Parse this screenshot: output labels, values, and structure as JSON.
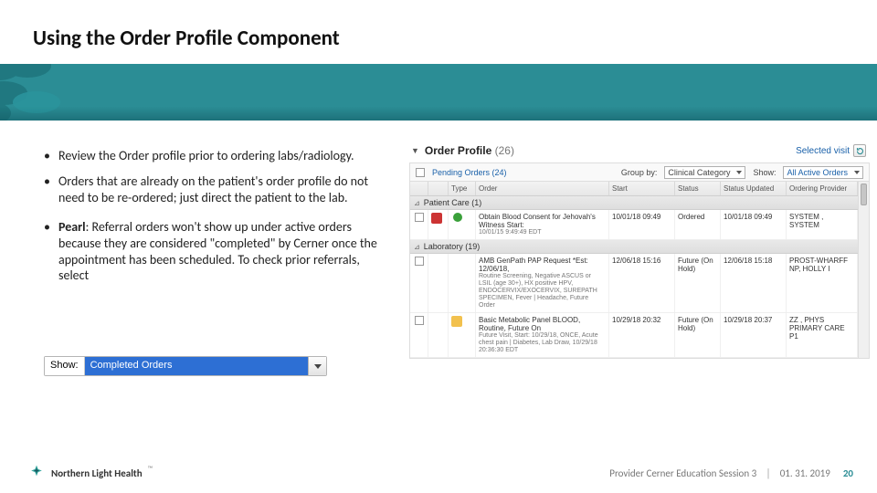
{
  "title": "Using the Order Profile Component",
  "bullets": [
    "Review the Order profile prior to ordering labs/radiology.",
    "Orders that are already on the patient's order profile do not need to be re-ordered; just direct the patient to the lab.",
    "Pearl: Referral orders won't show up under active orders because they are considered \"completed\" by Cerner once the appointment has been scheduled.  To check prior referrals, select"
  ],
  "dropdown": {
    "label": "Show:",
    "value": "Completed Orders"
  },
  "panel": {
    "title": "Order Profile",
    "count": "(26)",
    "selected_visit": "Selected visit",
    "filter": {
      "pending": "Pending Orders (24)",
      "group_lbl": "Group by:",
      "group_val": "Clinical Category",
      "show_lbl": "Show:",
      "show_val": "All Active Orders"
    },
    "columns": [
      "",
      "",
      "Type",
      "Order",
      "Start",
      "Status",
      "Status Updated",
      "Ordering Provider"
    ],
    "groups": [
      {
        "label": "Patient Care (1)",
        "rows": [
          {
            "order": "Obtain Blood Consent for Jehovah's Witness Start:",
            "sub": "10/01/15 9:49:49 EDT",
            "start": "10/01/18 09:49",
            "status": "Ordered",
            "updated": "10/01/18 09:49",
            "provider": "SYSTEM , SYSTEM",
            "icon": "red-green"
          }
        ]
      },
      {
        "label": "Laboratory (19)",
        "rows": [
          {
            "order": "AMB GenPath PAP Request  *Est: 12/06/18,",
            "sub": "Routine Screening, Negative ASCUS or LSIL (age 30+), HX positive HPV, ENDOCERVIX/EXOCERVIX, SUREPATH SPECIMEN, Fever | Headache, Future Order",
            "start": "12/06/18 15:16",
            "status": "Future (On Hold)",
            "updated": "12/06/18 15:18",
            "provider": "PROST-WHARFF NP, HOLLY I",
            "icon": ""
          },
          {
            "order": "Basic Metabolic Panel  BLOOD, Routine, Future On",
            "sub": "Future Visit, Start: 10/29/18, ONCE, Acute chest pain | Diabetes, Lab Draw, 10/29/18 20:36:30 EDT",
            "start": "10/29/18 20:32",
            "status": "Future (On Hold)",
            "updated": "10/29/18 20:37",
            "provider": "ZZ , PHYS PRIMARY CARE P1",
            "icon": "yellow"
          }
        ]
      }
    ]
  },
  "footer": {
    "brand": "Northern Light Health",
    "session": "Provider Cerner Education Session 3",
    "date": "01. 31. 2019",
    "page": "20"
  }
}
